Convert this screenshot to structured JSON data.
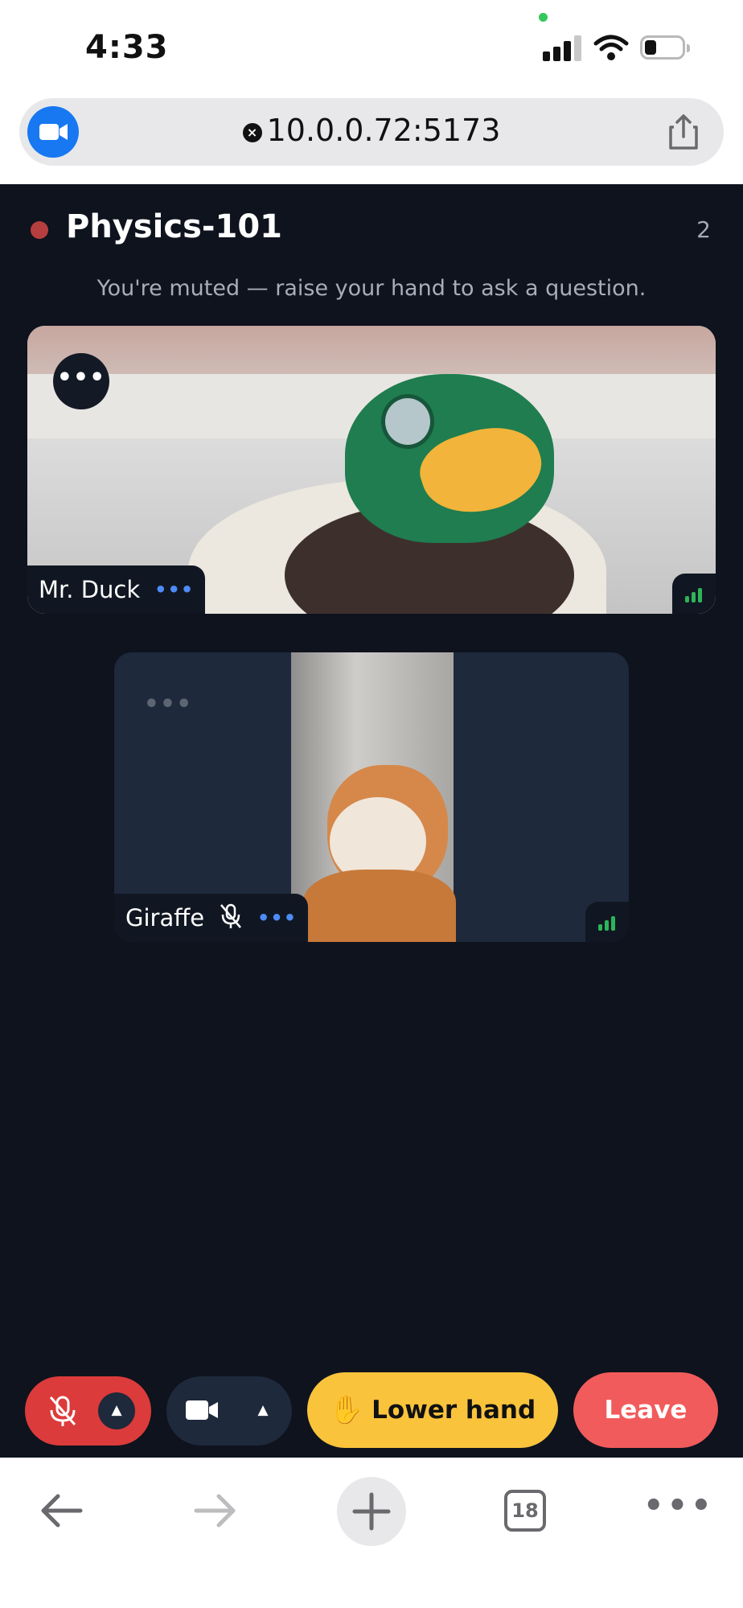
{
  "status_bar": {
    "time": "4:33"
  },
  "url_bar": {
    "url": "10.0.0.72:5173",
    "app_icon": "video-camera-icon",
    "share_icon": "share-icon"
  },
  "meeting": {
    "room_title": "Physics-101",
    "participant_count": "2",
    "muted_message": "You're muted — raise your hand to ask a question.",
    "participants": [
      {
        "name": "Mr. Duck",
        "more": "•••",
        "signal": "good"
      },
      {
        "name": "Giraffe",
        "more": "•••",
        "muted": true,
        "signal": "good"
      }
    ],
    "tile_menu": "•••"
  },
  "controls": {
    "mic_caret": "▲",
    "cam_caret": "▲",
    "hand_icon": "✋",
    "lower_hand_label": "Lower hand",
    "leave_label": "Leave"
  },
  "browser_toolbar": {
    "tab_count": "18",
    "more": "•••"
  },
  "colors": {
    "meeting_bg": "#0e131e",
    "mic_muted": "#dc3b3b",
    "hand": "#f9c33c",
    "leave": "#f25b5b",
    "accent_blue": "#1778f2"
  }
}
